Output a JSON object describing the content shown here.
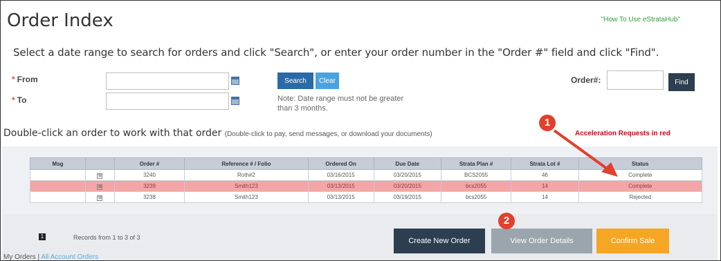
{
  "page": {
    "title": "Order Index",
    "help_link": "\"How To Use eStrataHub\"",
    "instructions": "Select a date range to search for orders and click \"Search\", or enter your order number in the \"Order #\" field and click \"Find\"."
  },
  "search_form": {
    "required_mark": "*",
    "from_label": "From",
    "to_label": "To",
    "from_value": "",
    "to_value": "",
    "search_button": "Search",
    "clear_button": "Clear",
    "note": "Note: Date range must not be greater than 3 months.",
    "order_label": "Order#:",
    "order_value": "",
    "find_button": "Find"
  },
  "hint": {
    "heading": "Double-click an order to work with that order",
    "detail": "(Double-click to pay, send messages, or download your documents)",
    "acceleration": "Acceleration Requests in red"
  },
  "grid": {
    "columns": [
      "Msg",
      "",
      "Order #",
      "Reference # / Folio",
      "Ordered On",
      "Due Date",
      "Strata Plan #",
      "Strata Lot #",
      "Status"
    ],
    "expand_glyph": "⊞",
    "rows": [
      {
        "msg": "",
        "order": "3240",
        "reference": "Roth#2",
        "ordered_on": "03/16/2015",
        "due_date": "03/20/2015",
        "plan": "BCS2055",
        "lot": "46",
        "status": "Complete",
        "selected": false
      },
      {
        "msg": "",
        "order": "3239",
        "reference": "Smith123",
        "ordered_on": "03/13/2015",
        "due_date": "03/20/2015",
        "plan": "bcs2055",
        "lot": "14",
        "status": "Complete",
        "selected": true
      },
      {
        "msg": "",
        "order": "3238",
        "reference": "Smith123",
        "ordered_on": "03/13/2015",
        "due_date": "03/19/2015",
        "plan": "bcs2055",
        "lot": "14",
        "status": "Rejected",
        "selected": false
      }
    ]
  },
  "footer": {
    "page_number": "1",
    "records_text": "Records from 1 to 3 of 3",
    "create_button": "Create New Order",
    "view_button": "View Order Details",
    "confirm_button": "Confirm Sale",
    "my_orders": "My Orders",
    "separator": " | ",
    "all_orders": "All Account Orders"
  },
  "annotations": {
    "marker_1": "1",
    "marker_2": "2"
  },
  "colors": {
    "accent_blue": "#2a6aa8",
    "clear_blue": "#4aa3df",
    "selected_row": "#f2a6a6",
    "dark_button": "#2c3e50",
    "disabled_button": "#9aa5ad",
    "confirm_orange": "#f5a623",
    "annotation_red": "#e0402d"
  }
}
